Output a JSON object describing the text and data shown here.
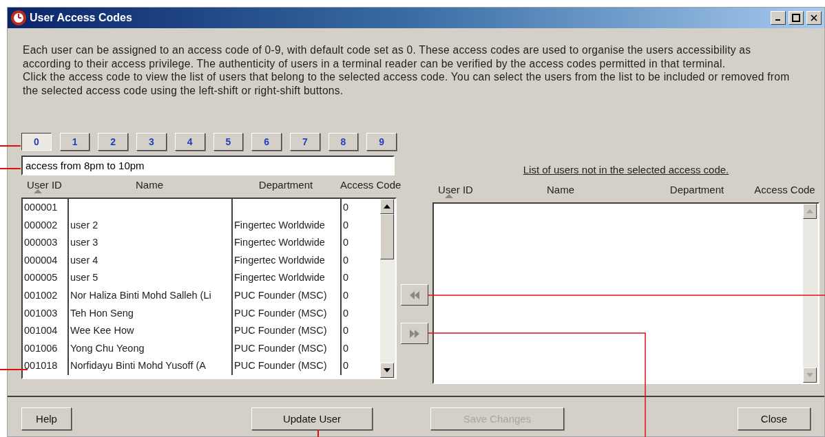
{
  "window": {
    "title": "User Access Codes"
  },
  "description": [
    "Each user can be assigned to an access code of 0-9, with default code set as 0. These access codes are used to organise the users accessibility as according to their access privilege. The authenticity of users in a terminal reader can be verified by the access codes permitted in that terminal.",
    "Click the access code to view the list of users that belong to the selected access code. You can select the users from the list to be included or removed from the selected access code using the left-shift or right-shift buttons."
  ],
  "access_code_tabs": [
    {
      "label": "0",
      "selected": true
    },
    {
      "label": "1",
      "selected": false
    },
    {
      "label": "2",
      "selected": false
    },
    {
      "label": "3",
      "selected": false
    },
    {
      "label": "4",
      "selected": false
    },
    {
      "label": "5",
      "selected": false
    },
    {
      "label": "6",
      "selected": false
    },
    {
      "label": "7",
      "selected": false
    },
    {
      "label": "8",
      "selected": false
    },
    {
      "label": "9",
      "selected": false
    }
  ],
  "code_description": {
    "value": "access from 8pm to 10pm"
  },
  "left_table": {
    "columns": [
      {
        "label": "User ID",
        "sorted": true
      },
      {
        "label": "Name",
        "sorted": false
      },
      {
        "label": "Department",
        "sorted": false
      },
      {
        "label": "Access Code",
        "sorted": false
      }
    ],
    "rows": [
      [
        "000001",
        "",
        "",
        "0"
      ],
      [
        "000002",
        "user 2",
        "Fingertec Worldwide",
        "0"
      ],
      [
        "000003",
        "user 3",
        "Fingertec Worldwide",
        "0"
      ],
      [
        "000004",
        "user 4",
        "Fingertec Worldwide",
        "0"
      ],
      [
        "000005",
        "user 5",
        "Fingertec Worldwide",
        "0"
      ],
      [
        "001002",
        "Nor Haliza Binti Mohd Salleh (Li",
        "PUC Founder (MSC)",
        "0"
      ],
      [
        "001003",
        "Teh Hon Seng",
        "PUC Founder (MSC)",
        "0"
      ],
      [
        "001004",
        "Wee Kee How",
        "PUC Founder (MSC)",
        "0"
      ],
      [
        "001006",
        "Yong Chu Yeong",
        "PUC Founder (MSC)",
        "0"
      ],
      [
        "001018",
        "Norfidayu Binti Mohd Yusoff (A",
        "PUC Founder (MSC)",
        "0"
      ]
    ]
  },
  "right_table": {
    "title": "List of users not in the selected access code.",
    "columns": [
      {
        "label": "User ID",
        "sorted": true
      },
      {
        "label": "Name",
        "sorted": false
      },
      {
        "label": "Department",
        "sorted": false
      },
      {
        "label": "Access Code",
        "sorted": false
      }
    ]
  },
  "buttons": [
    {
      "label": "Help",
      "disabled": false
    },
    {
      "label": "Update User",
      "disabled": false
    },
    {
      "label": "Save Changes",
      "disabled": true
    },
    {
      "label": "Close",
      "disabled": false
    }
  ]
}
